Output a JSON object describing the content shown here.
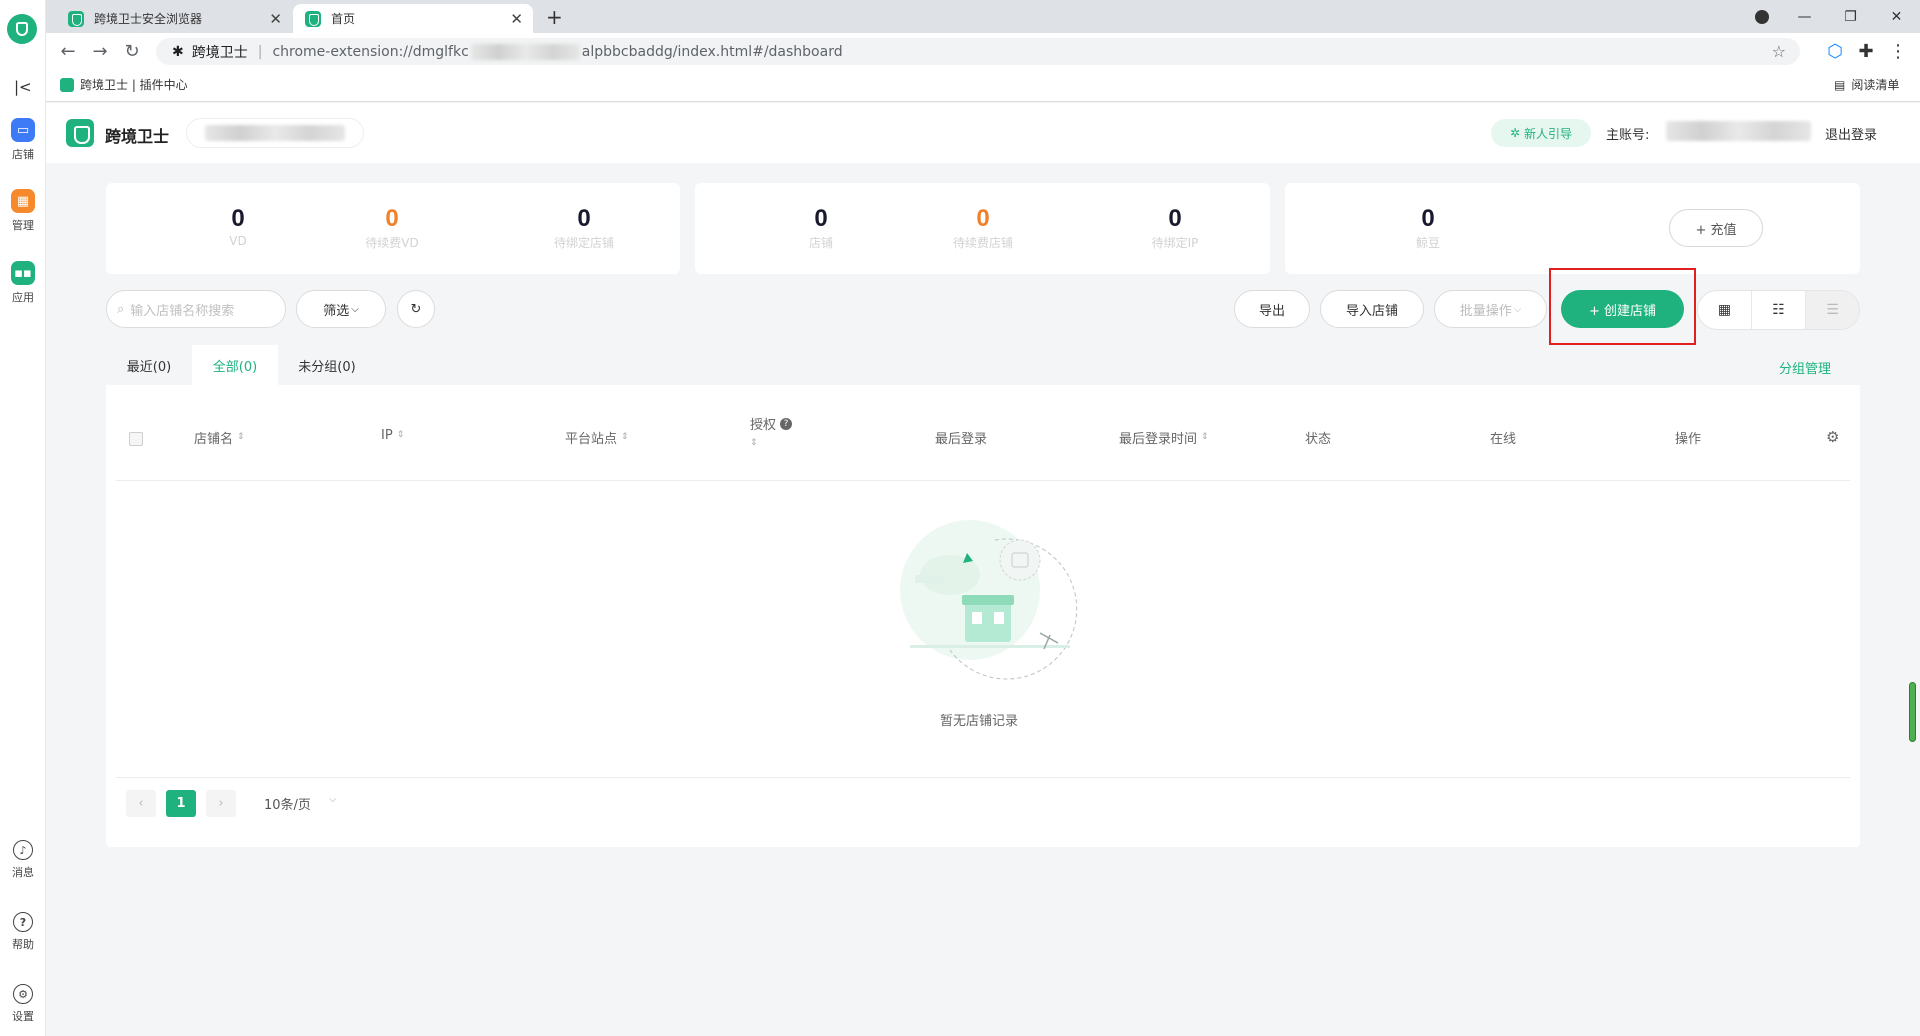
{
  "browser": {
    "tabs": [
      {
        "title": "跨境卫士安全浏览器"
      },
      {
        "title": "首页"
      }
    ],
    "new_tab": "+",
    "url_prefix": "跨境卫士",
    "url_a": "chrome-extension://dmglfkc",
    "url_b": "alpbbcbaddg/index.html#/dashboard",
    "bookmark": "跨境卫士 | 插件中心",
    "reading_list": "阅读清单"
  },
  "rail": {
    "items": [
      {
        "label": "店铺",
        "color": "#3c7bf5"
      },
      {
        "label": "管理",
        "color": "#f5892c"
      },
      {
        "label": "应用",
        "color": "#1fb27e"
      }
    ],
    "bottom": [
      {
        "label": "消息"
      },
      {
        "label": "帮助"
      },
      {
        "label": "设置"
      }
    ]
  },
  "header": {
    "brand": "跨境卫士",
    "guide": "新人引导",
    "main_account_label": "主账号:",
    "logout": "退出登录"
  },
  "stats": {
    "card1": [
      {
        "value": "0",
        "label": "VD"
      },
      {
        "value": "0",
        "label": "待续费VD"
      },
      {
        "value": "0",
        "label": "待绑定店铺"
      }
    ],
    "card2": [
      {
        "value": "0",
        "label": "店铺"
      },
      {
        "value": "0",
        "label": "待续费店铺"
      },
      {
        "value": "0",
        "label": "待绑定IP"
      }
    ],
    "card3": [
      {
        "value": "0",
        "label": "鲸豆"
      }
    ],
    "recharge": "+ 充值"
  },
  "toolbar": {
    "search_placeholder": "输入店铺名称搜索",
    "filter": "筛选",
    "export": "导出",
    "import": "导入店铺",
    "batch": "批量操作",
    "create": "+ 创建店铺"
  },
  "table": {
    "tabs": [
      "最近(0)",
      "全部(0)",
      "未分组(0)"
    ],
    "group_mgmt": "分组管理",
    "columns": [
      "店铺名",
      "IP",
      "平台站点",
      "授权",
      "最后登录",
      "最后登录时间",
      "状态",
      "在线",
      "操作"
    ],
    "empty": "暂无店铺记录",
    "page": "1",
    "page_size": "10条/页"
  },
  "colors": {
    "accent": "#1fb27e",
    "orange": "#f0802c",
    "highlight_box": "#e02020"
  }
}
